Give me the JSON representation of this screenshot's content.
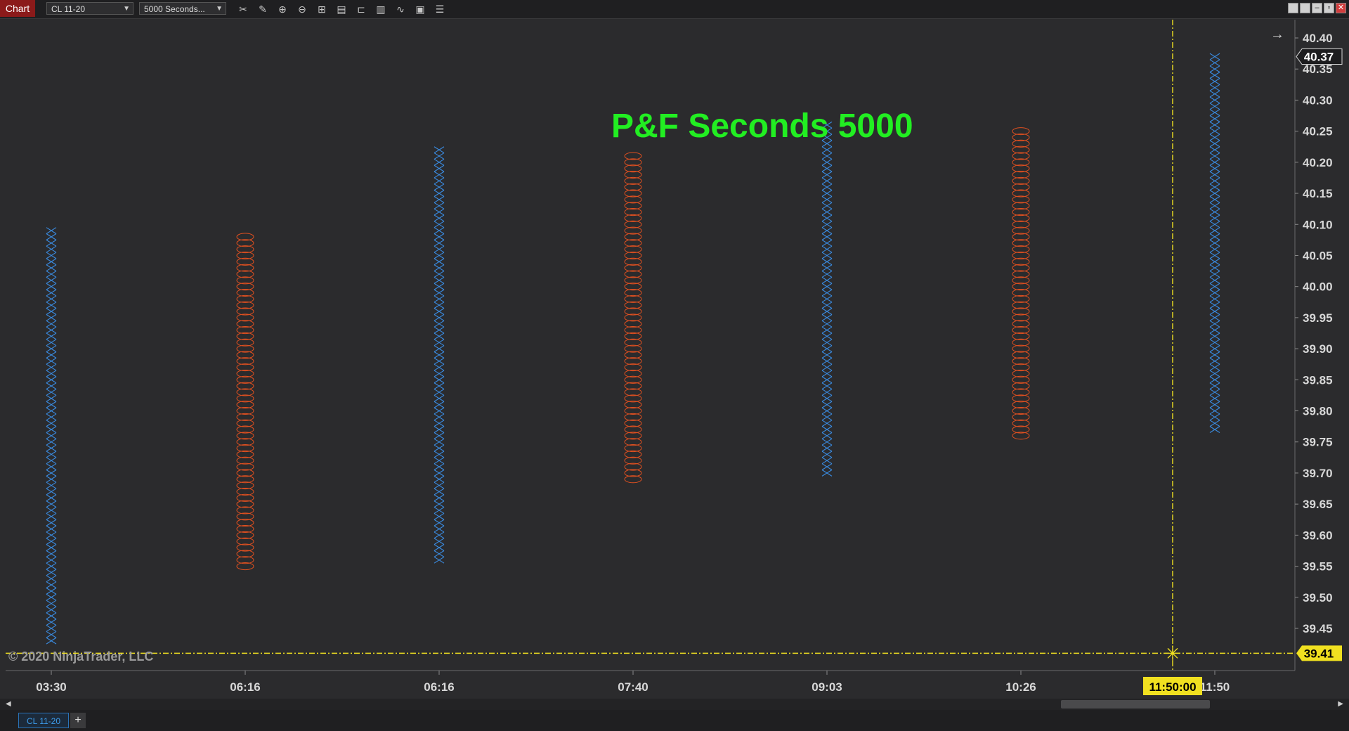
{
  "toolbar": {
    "tab_label": "Chart",
    "instrument": "CL 11-20",
    "interval": "5000 Seconds...",
    "icons": [
      "crosshair-icon",
      "pencil-icon",
      "zoom-in-icon",
      "zoom-out-icon",
      "grid-icon",
      "properties-icon",
      "template-icon",
      "data-box-icon",
      "strategy-icon",
      "calculator-icon",
      "list-icon"
    ]
  },
  "window_buttons": [
    "restore-icon",
    "restore-icon",
    "minimize-icon",
    "maximize-icon",
    "close-icon"
  ],
  "title_overlay": "P&F Seconds 5000",
  "copyright": "© 2020 NinjaTrader, LLC",
  "current_price_label": "40.37",
  "crosshair_price_label": "39.41",
  "crosshair_time_label": "11:50:00",
  "bottom_tabs": {
    "instrument_tab": "CL 11-20",
    "add_label": "+"
  },
  "colors": {
    "up": "#3a8be0",
    "down": "#e05020",
    "title": "#22ee22",
    "crosshair": "#f0e020",
    "background": "#2b2b2d"
  },
  "chart_data": {
    "type": "point-and-figure",
    "title": "P&F Seconds 5000",
    "box_size": 0.01,
    "ylim": [
      39.4,
      40.42
    ],
    "y_ticks": [
      "40.40",
      "40.35",
      "40.30",
      "40.25",
      "40.20",
      "40.15",
      "40.10",
      "40.05",
      "40.00",
      "39.95",
      "39.90",
      "39.85",
      "39.80",
      "39.75",
      "39.70",
      "39.65",
      "39.60",
      "39.55",
      "39.50",
      "39.45"
    ],
    "x_ticks": [
      "03:30",
      "06:16",
      "06:16",
      "07:40",
      "09:03",
      "10:26",
      "11:50"
    ],
    "columns": [
      {
        "label": "03:30",
        "kind": "X",
        "low": 39.43,
        "high": 40.09
      },
      {
        "label": "06:16",
        "kind": "O",
        "low": 39.55,
        "high": 40.08
      },
      {
        "label": "06:16",
        "kind": "X",
        "low": 39.56,
        "high": 40.22
      },
      {
        "label": "07:40",
        "kind": "O",
        "low": 39.69,
        "high": 40.21
      },
      {
        "label": "09:03",
        "kind": "X",
        "low": 39.7,
        "high": 40.26
      },
      {
        "label": "10:26",
        "kind": "O",
        "low": 39.76,
        "high": 40.25
      },
      {
        "label": "11:50",
        "kind": "X",
        "low": 39.77,
        "high": 40.37
      }
    ]
  }
}
